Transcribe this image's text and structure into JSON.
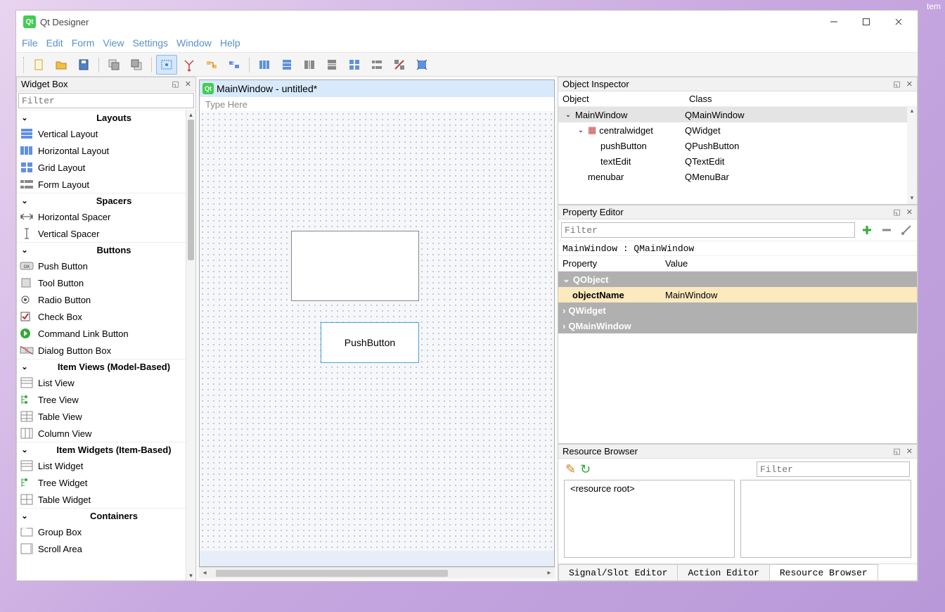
{
  "corner": "tem",
  "app": {
    "title": "Qt Designer"
  },
  "menubar": [
    "File",
    "Edit",
    "Form",
    "View",
    "Settings",
    "Window",
    "Help"
  ],
  "widgetBox": {
    "title": "Widget Box",
    "filterPlaceholder": "Filter",
    "categories": [
      {
        "name": "Layouts",
        "items": [
          "Vertical Layout",
          "Horizontal Layout",
          "Grid Layout",
          "Form Layout"
        ]
      },
      {
        "name": "Spacers",
        "items": [
          "Horizontal Spacer",
          "Vertical Spacer"
        ]
      },
      {
        "name": "Buttons",
        "items": [
          "Push Button",
          "Tool Button",
          "Radio Button",
          "Check Box",
          "Command Link Button",
          "Dialog Button Box"
        ]
      },
      {
        "name": "Item Views (Model-Based)",
        "items": [
          "List View",
          "Tree View",
          "Table View",
          "Column View"
        ]
      },
      {
        "name": "Item Widgets (Item-Based)",
        "items": [
          "List Widget",
          "Tree Widget",
          "Table Widget"
        ]
      },
      {
        "name": "Containers",
        "items": [
          "Group Box",
          "Scroll Area"
        ]
      }
    ]
  },
  "form": {
    "title": "MainWindow - untitled*",
    "menuHint": "Type Here",
    "buttonLabel": "PushButton"
  },
  "objectInspector": {
    "title": "Object Inspector",
    "headers": {
      "object": "Object",
      "class": "Class"
    },
    "tree": [
      {
        "obj": "MainWindow",
        "cls": "QMainWindow",
        "depth": 0,
        "exp": true,
        "sel": true
      },
      {
        "obj": "centralwidget",
        "cls": "QWidget",
        "depth": 1,
        "exp": true
      },
      {
        "obj": "pushButton",
        "cls": "QPushButton",
        "depth": 2
      },
      {
        "obj": "textEdit",
        "cls": "QTextEdit",
        "depth": 2
      },
      {
        "obj": "menubar",
        "cls": "QMenuBar",
        "depth": 1
      }
    ]
  },
  "propertyEditor": {
    "title": "Property Editor",
    "filterPlaceholder": "Filter",
    "context": "MainWindow : QMainWindow",
    "headers": {
      "property": "Property",
      "value": "Value"
    },
    "groups": [
      {
        "name": "QObject",
        "expanded": true,
        "rows": [
          {
            "prop": "objectName",
            "val": "MainWindow"
          }
        ]
      },
      {
        "name": "QWidget",
        "expanded": false,
        "rows": []
      },
      {
        "name": "QMainWindow",
        "expanded": false,
        "rows": []
      }
    ]
  },
  "resourceBrowser": {
    "title": "Resource Browser",
    "filterPlaceholder": "Filter",
    "root": "<resource root>",
    "tabs": [
      "Signal/Slot Editor",
      "Action Editor",
      "Resource Browser"
    ],
    "activeTab": 2
  }
}
